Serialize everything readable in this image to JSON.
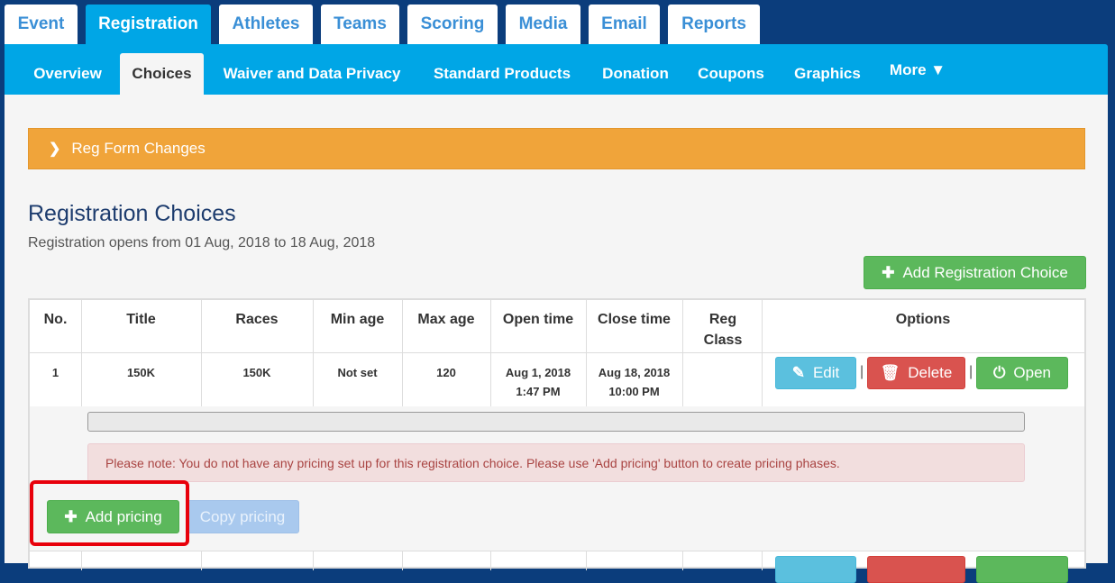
{
  "top_tabs": [
    "Event",
    "Registration",
    "Athletes",
    "Teams",
    "Scoring",
    "Media",
    "Email",
    "Reports"
  ],
  "top_tab_active": "Registration",
  "sub_tabs": [
    "Overview",
    "Choices",
    "Waiver and Data Privacy",
    "Standard Products",
    "Donation",
    "Coupons",
    "Graphics",
    "More ▼"
  ],
  "sub_tab_active": "Choices",
  "reg_form_bar": {
    "icon": "chevron-right-icon",
    "label": "Reg Form Changes"
  },
  "page": {
    "title": "Registration Choices",
    "subtitle": "Registration opens from 01 Aug, 2018 to 18 Aug, 2018",
    "add_choice_button": "Add Registration Choice"
  },
  "table": {
    "headers": [
      "No.",
      "Title",
      "Races",
      "Min age",
      "Max age",
      "Open time",
      "Close time",
      "Reg Class",
      "Options"
    ],
    "rows": [
      {
        "no": "1",
        "title": "150K",
        "races": "150K",
        "min_age": "Not set",
        "max_age": "120",
        "open_date": "Aug 1, 2018",
        "open_time": "1:47 PM",
        "close_date": "Aug 18, 2018",
        "close_time": "10:00 PM",
        "reg_class": "",
        "options": {
          "edit": "Edit",
          "delete": "Delete",
          "open": "Open",
          "separator": "|"
        }
      }
    ]
  },
  "pricing": {
    "notice": "Please note: You do not have any pricing set up for this registration choice. Please use 'Add pricing' button to create pricing phases.",
    "add_button": "Add pricing",
    "copy_button": "Copy pricing"
  },
  "colors": {
    "brand_blue": "#00a6e6",
    "navy": "#0b3d7c",
    "orange": "#f0a43a",
    "green": "#5cb85c",
    "red": "#d9534f",
    "info": "#5bc0de",
    "highlight": "#e8000b"
  }
}
